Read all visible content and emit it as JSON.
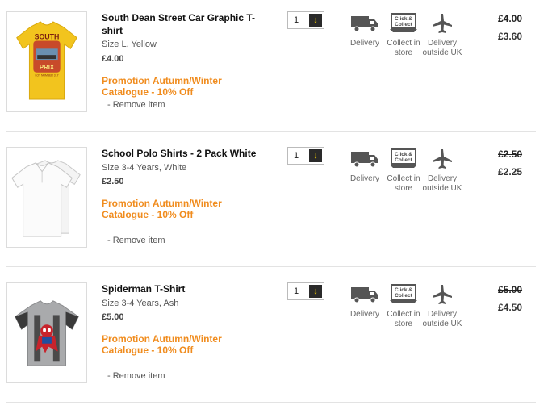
{
  "items": [
    {
      "title": "South Dean Street Car Graphic T-shirt",
      "variant": "Size L, Yellow",
      "unit_price": "£4.00",
      "promo": "Promotion Autumn/Winter Catalogue - 10% Off",
      "remove_label": "- Remove item",
      "quantity": "1",
      "delivery": [
        "Delivery",
        "Collect in store",
        "Delivery outside UK"
      ],
      "old_price": "£4.00",
      "new_price": "£3.60",
      "image": "yellow-car-graphic-tshirt",
      "shirt_text": [
        "SOUTH",
        "PRIX",
        "LOT NUMBER 317"
      ]
    },
    {
      "title": "School Polo Shirts - 2 Pack White",
      "variant": "Size 3-4 Years, White",
      "unit_price": "£2.50",
      "promo": "Promotion Autumn/Winter Catalogue - 10% Off",
      "remove_label": "- Remove item",
      "quantity": "1",
      "delivery": [
        "Delivery",
        "Collect in store",
        "Delivery outside UK"
      ],
      "old_price": "£2.50",
      "new_price": "£2.25",
      "image": "white-polo-shirts"
    },
    {
      "title": "Spiderman T-Shirt",
      "variant": "Size 3-4 Years, Ash",
      "unit_price": "£5.00",
      "promo": "Promotion Autumn/Winter Catalogue - 10% Off",
      "remove_label": "- Remove item",
      "quantity": "1",
      "delivery": [
        "Delivery",
        "Collect in store",
        "Delivery outside UK"
      ],
      "old_price": "£5.00",
      "new_price": "£4.50",
      "image": "grey-spiderman-tshirt"
    }
  ],
  "icons": {
    "delivery": "truck-icon",
    "collect": "click-and-collect-icon",
    "overseas": "airplane-icon",
    "collect_badge": [
      "Click &",
      "Collect"
    ]
  },
  "colors": {
    "promo": "#f08c1e",
    "qty_button_bg": "#2a2a2a",
    "qty_button_fg": "#f5d000",
    "yellow_shirt": "#f2c41e"
  }
}
